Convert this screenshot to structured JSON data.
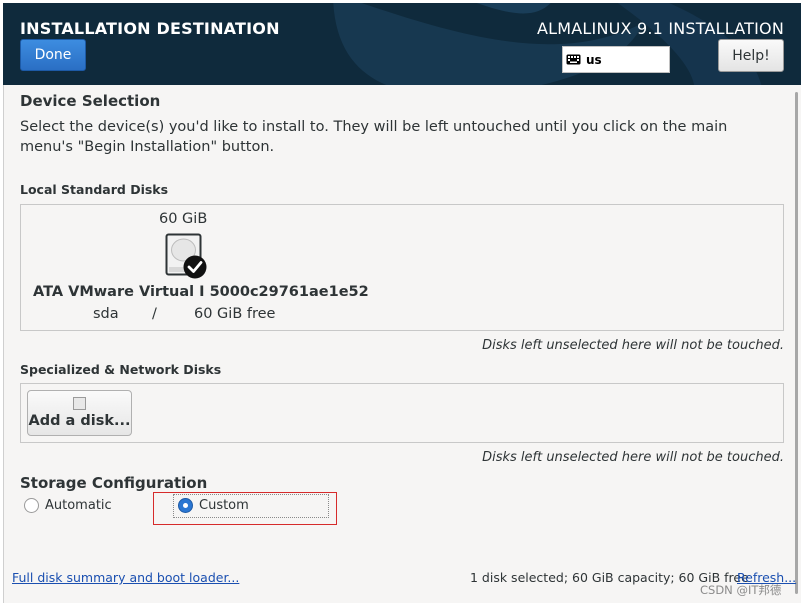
{
  "header": {
    "title": "INSTALLATION DESTINATION",
    "product": "ALMALINUX 9.1 INSTALLATION",
    "done_label": "Done",
    "keyboard_layout": "us",
    "help_label": "Help!"
  },
  "device_selection": {
    "title": "Device Selection",
    "intro": "Select the device(s) you'd like to install to.  They will be left untouched until you click on the main menu's \"Begin Installation\" button."
  },
  "local_disks": {
    "title": "Local Standard Disks",
    "disks": [
      {
        "size": "60 GiB",
        "name": "ATA VMware Virtual I 5000c29761ae1e52",
        "device": "sda",
        "separator": "/",
        "free": "60 GiB free",
        "selected": true
      }
    ],
    "note": "Disks left unselected here will not be touched."
  },
  "specialized": {
    "title": "Specialized & Network Disks",
    "add_label": "Add a disk...",
    "note": "Disks left unselected here will not be touched."
  },
  "storage": {
    "title": "Storage Configuration",
    "options": [
      {
        "label": "Automatic",
        "selected": false
      },
      {
        "label": "Custom",
        "selected": true
      }
    ]
  },
  "footer": {
    "summary_link": "Full disk summary and boot loader...",
    "status": "1 disk selected; 60 GiB capacity; 60 GiB free",
    "refresh_link": "Refresh..."
  },
  "watermark": "CSDN @IT邦德",
  "colors": {
    "header_bg": "#0f2a3c",
    "accent": "#2a76d2",
    "highlight_box": "#d62b2b",
    "link": "#1a4fb0"
  }
}
